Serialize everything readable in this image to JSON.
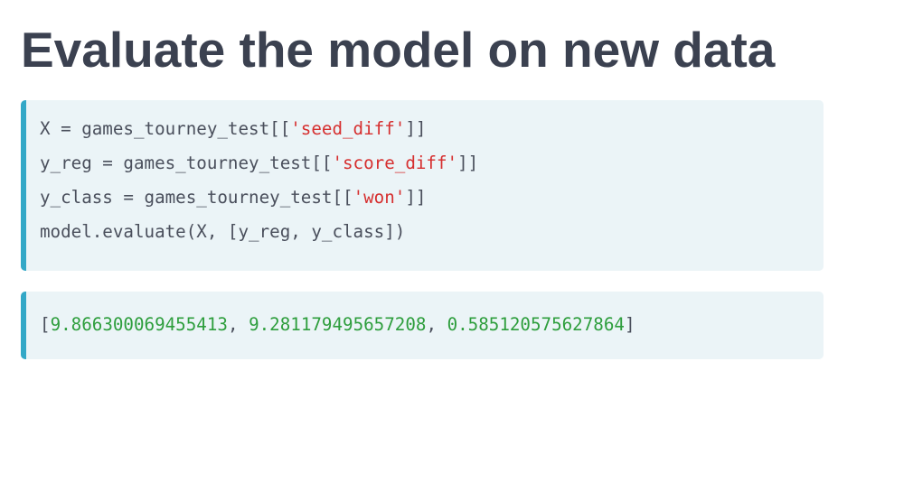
{
  "title": "Evaluate the model on new data",
  "input_code": {
    "line1": {
      "before": "X = games_tourney_test[[",
      "string": "'seed_diff'",
      "after": "]]"
    },
    "line2": {
      "before": "y_reg = games_tourney_test[[",
      "string": "'score_diff'",
      "after": "]]"
    },
    "line3": {
      "before": "y_class = games_tourney_test[[",
      "string": "'won'",
      "after": "]]"
    },
    "line4": "model.evaluate(X, [y_reg, y_class])"
  },
  "output": {
    "open": "[",
    "values": [
      "9.866300069455413",
      "9.281179495657208",
      "0.585120575627864"
    ],
    "separator": ", ",
    "close": "]"
  },
  "colors": {
    "title": "#3b4150",
    "code_text": "#4a4f5c",
    "string": "#d62f2f",
    "number": "#2e9e3d",
    "box_background": "#ebf4f7",
    "accent_bar": "#33a8c7"
  }
}
